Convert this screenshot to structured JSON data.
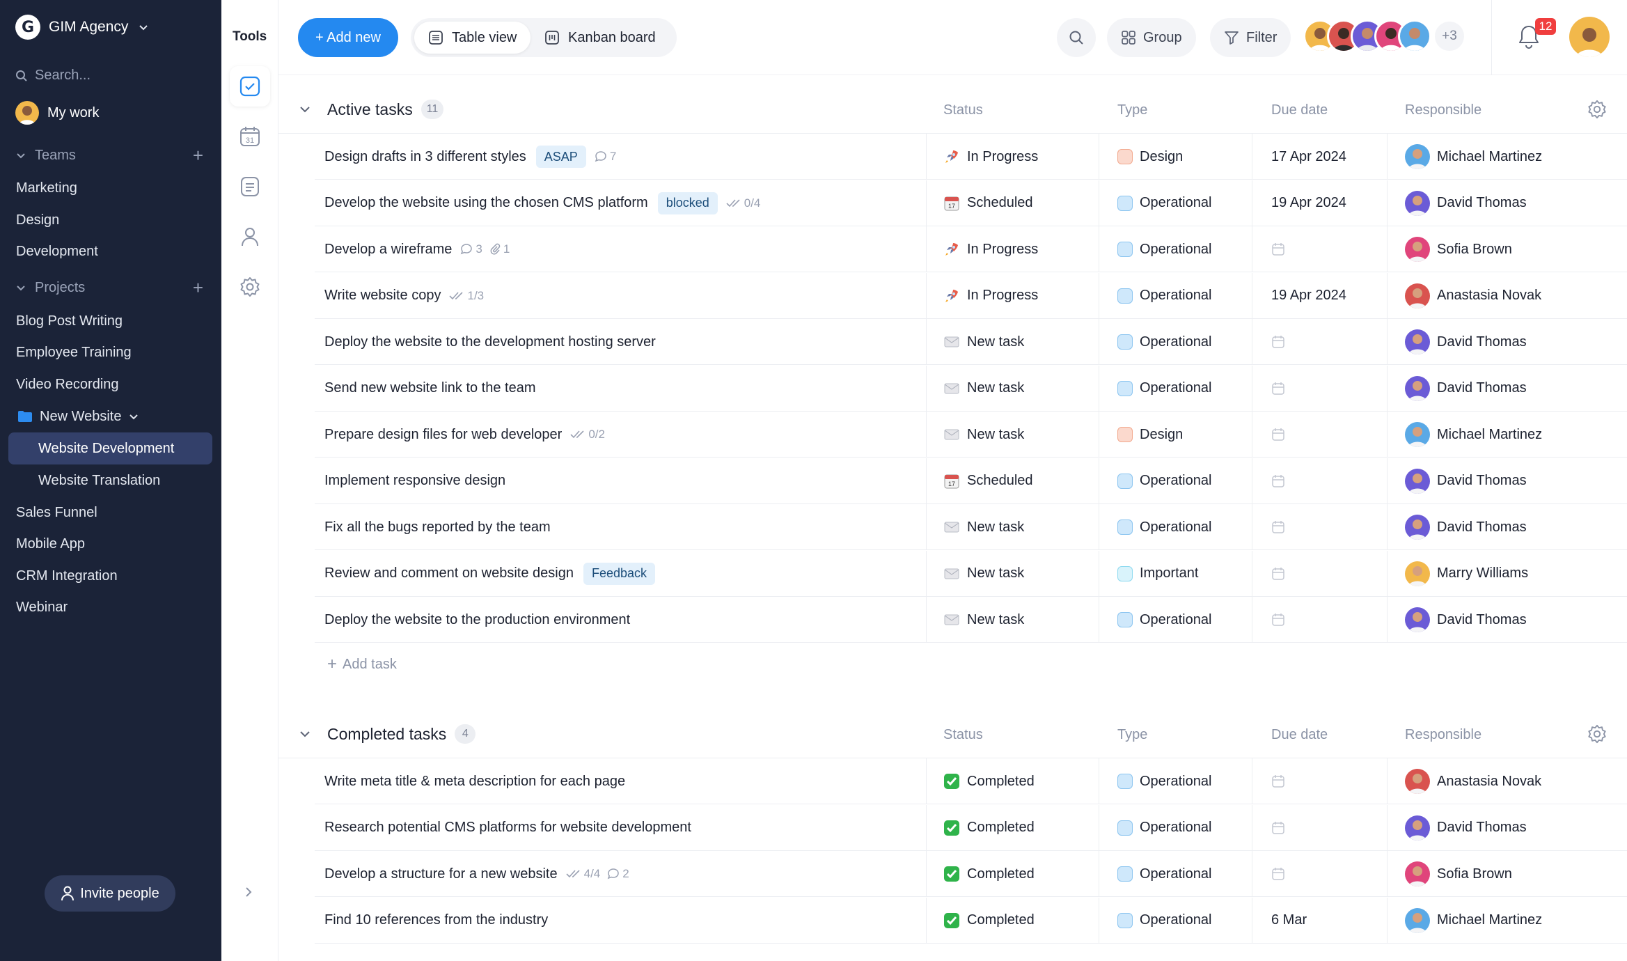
{
  "workspace": {
    "name": "GIM Agency",
    "logo_letter": "G"
  },
  "sidebar": {
    "search_placeholder": "Search...",
    "my_work": "My work",
    "teams_label": "Teams",
    "teams": [
      "Marketing",
      "Design",
      "Development"
    ],
    "projects_label": "Projects",
    "projects": [
      "Blog Post Writing",
      "Employee Training",
      "Video Recording"
    ],
    "folder": {
      "name": "New Website",
      "children": [
        "Website Development",
        "Website Translation"
      ],
      "active": "Website Development"
    },
    "projects_after": [
      "Sales Funnel",
      "Mobile App",
      "CRM Integration",
      "Webinar"
    ],
    "invite_label": "Invite people"
  },
  "tools": {
    "title": "Tools",
    "items": [
      "tasks-icon",
      "calendar-icon",
      "notes-icon",
      "people-icon",
      "settings-icon"
    ],
    "calendar_day": "31"
  },
  "toolbar": {
    "add_new": "+ Add new",
    "views": [
      "Table view",
      "Kanban board"
    ],
    "active_view": "Table view",
    "group_label": "Group",
    "filter_label": "Filter",
    "extra_members": "+3",
    "notifications": "12"
  },
  "columns": [
    "Status",
    "Type",
    "Due date",
    "Responsible"
  ],
  "colors": {
    "accent": "#2489f0",
    "sidebar": "#1b2338",
    "design": "#f7c7b4",
    "operational": "#b8dcf8",
    "important": "#c6ecf8"
  },
  "active_group": {
    "title": "Active tasks",
    "count": "11",
    "tasks": [
      {
        "name": "Design drafts in 3 different styles",
        "tag": "ASAP",
        "comments": "7",
        "status": "In Progress",
        "status_icon": "rocket",
        "type": "Design",
        "due": "17 Apr 2024",
        "responsible": "Michael Martinez",
        "av": "#5aa9e6"
      },
      {
        "name": "Develop the website using the chosen CMS platform",
        "tag": "blocked",
        "checks": "0/4",
        "status": "Scheduled",
        "status_icon": "calendar",
        "type": "Operational",
        "due": "19 Apr 2024",
        "responsible": "David Thomas",
        "av": "#6b5bd6"
      },
      {
        "name": "Develop a wireframe",
        "comments": "3",
        "attach": "1",
        "status": "In Progress",
        "status_icon": "rocket",
        "type": "Operational",
        "due": "",
        "responsible": "Sofia Brown",
        "av": "#e0457b"
      },
      {
        "name": "Write website copy",
        "checks": "1/3",
        "status": "In Progress",
        "status_icon": "rocket",
        "type": "Operational",
        "due": "19 Apr 2024",
        "responsible": "Anastasia Novak",
        "av": "#d9534f"
      },
      {
        "name": "Deploy the website to the development hosting server",
        "status": "New task",
        "status_icon": "envelope",
        "type": "Operational",
        "due": "",
        "responsible": "David Thomas",
        "av": "#6b5bd6"
      },
      {
        "name": "Send new website link to the team",
        "status": "New task",
        "status_icon": "envelope",
        "type": "Operational",
        "due": "",
        "responsible": "David Thomas",
        "av": "#6b5bd6"
      },
      {
        "name": "Prepare design files for web developer",
        "checks": "0/2",
        "status": "New task",
        "status_icon": "envelope",
        "type": "Design",
        "due": "",
        "responsible": "Michael Martinez",
        "av": "#5aa9e6"
      },
      {
        "name": "Implement responsive design",
        "status": "Scheduled",
        "status_icon": "calendar",
        "type": "Operational",
        "due": "",
        "responsible": "David Thomas",
        "av": "#6b5bd6"
      },
      {
        "name": "Fix all the bugs reported by the team",
        "status": "New task",
        "status_icon": "envelope",
        "type": "Operational",
        "due": "",
        "responsible": "David Thomas",
        "av": "#6b5bd6"
      },
      {
        "name": "Review and comment on website design",
        "tag": "Feedback",
        "status": "New task",
        "status_icon": "envelope",
        "type": "Important",
        "due": "",
        "responsible": "Marry Williams",
        "av": "#f2b84b"
      },
      {
        "name": "Deploy the website to the production environment",
        "status": "New task",
        "status_icon": "envelope",
        "type": "Operational",
        "due": "",
        "responsible": "David Thomas",
        "av": "#6b5bd6"
      }
    ],
    "add_task": "Add task"
  },
  "completed_group": {
    "title": "Completed tasks",
    "count": "4",
    "tasks": [
      {
        "name": "Write meta title & meta description for each page",
        "status": "Completed",
        "status_icon": "check",
        "type": "Operational",
        "due": "",
        "responsible": "Anastasia Novak",
        "av": "#d9534f"
      },
      {
        "name": "Research potential CMS platforms for website development",
        "status": "Completed",
        "status_icon": "check",
        "type": "Operational",
        "due": "",
        "responsible": "David Thomas",
        "av": "#6b5bd6"
      },
      {
        "name": "Develop a structure for a new website",
        "checks": "4/4",
        "comments": "2",
        "status": "Completed",
        "status_icon": "check",
        "type": "Operational",
        "due": "",
        "responsible": "Sofia Brown",
        "av": "#e0457b"
      },
      {
        "name": "Find 10 references from the industry",
        "status": "Completed",
        "status_icon": "check",
        "type": "Operational",
        "due": "6 Mar",
        "responsible": "Michael Martinez",
        "av": "#5aa9e6"
      }
    ]
  }
}
